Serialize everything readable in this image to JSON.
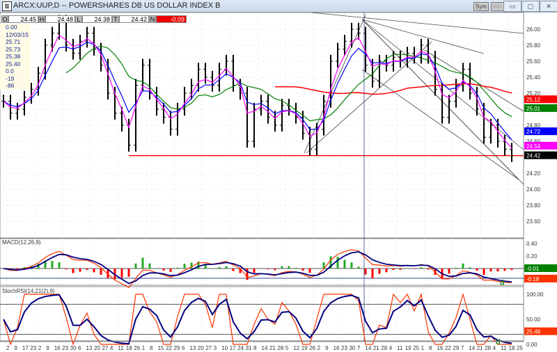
{
  "window": {
    "title": "ARCX:UUP,D -- POWERSHARES DB US DOLLAR INDEX B",
    "buttons": {
      "sym": "Sym",
      "info": "Info",
      "minimize": "▭",
      "restore": "▢",
      "close": "✕"
    }
  },
  "ohlc": {
    "o_label": "O",
    "open": "24.45",
    "h_label": "H",
    "high": "24.48",
    "l_label": "L",
    "low": "24.38",
    "c_label": "T",
    "close": "24.42",
    "n_label": "N",
    "change": "-0.09"
  },
  "info_box": [
    "0.00",
    "12/03/15",
    "25.71",
    "25.73",
    "25.38",
    "25.40",
    "0.0",
    "-19",
    "-86"
  ],
  "colors": {
    "ma_fast": "#ff00ff",
    "ma_mid": "#0000ff",
    "ma_slow": "#008000",
    "ma_long": "#ff0000",
    "support": "#ff0000",
    "macd": "#ff3300",
    "signal": "#000080",
    "hist_up": "#22aa22",
    "hist_down": "#ff0000"
  },
  "chart_data": [
    {
      "type": "bar",
      "title": "ARCX:UUP,D",
      "ylim": [
        23.5,
        26.2
      ],
      "y_ticks": [
        "26.00",
        "25.80",
        "25.60",
        "25.40",
        "25.20",
        "24.80",
        "24.60",
        "24.20",
        "24.00",
        "23.80",
        "23.60"
      ],
      "close": [
        25.1,
        24.95,
        25.0,
        25.15,
        25.25,
        25.45,
        25.8,
        25.95,
        26.1,
        25.8,
        25.7,
        25.85,
        25.95,
        25.75,
        25.55,
        25.2,
        24.95,
        24.8,
        24.55,
        25.3,
        25.55,
        25.2,
        25.0,
        24.9,
        24.75,
        25.0,
        25.2,
        25.3,
        25.5,
        25.4,
        25.3,
        25.5,
        25.6,
        25.3,
        25.2,
        24.6,
        25.0,
        25.1,
        24.9,
        24.8,
        25.05,
        25.0,
        24.9,
        24.7,
        24.5,
        24.75,
        25.1,
        25.6,
        25.75,
        25.85,
        26.0,
        25.95,
        25.55,
        25.35,
        25.6,
        25.55,
        25.65,
        25.6,
        25.7,
        25.65,
        25.8,
        25.65,
        25.25,
        24.9,
        25.1,
        25.3,
        25.5,
        25.2,
        25.0,
        24.65,
        24.8,
        24.6,
        24.5,
        24.42
      ],
      "support_level": 24.42,
      "value_labels": [
        {
          "text": "25.12",
          "color": "#ff0000"
        },
        {
          "text": "25.01",
          "color": "#008000"
        },
        {
          "text": "24.72",
          "color": "#0000ff"
        },
        {
          "text": "24.54",
          "color": "#ff00ff"
        },
        {
          "text": "24.42",
          "color": "#000000"
        }
      ]
    },
    {
      "type": "line",
      "title": "MACD(12,26,9)",
      "ylim": [
        -0.26,
        0.44
      ],
      "y_ticks": [
        "0.40",
        "0.20"
      ],
      "value_labels": [
        {
          "text": "-0.01",
          "color": "#008000"
        },
        {
          "text": "-0.18",
          "color": "#ff3300"
        }
      ],
      "annotation": "d"
    },
    {
      "type": "line",
      "title": "StochRSI(14,21(2),9)",
      "ylim": [
        -5,
        108
      ],
      "y_ticks": [
        "100.00",
        "50.00",
        "0.00"
      ],
      "levels": [
        80,
        20
      ],
      "value_labels": [
        {
          "text": "25.48",
          "color": "#ff3300"
        }
      ],
      "annotation": "d"
    }
  ],
  "x_ticks": [
    "2",
    "9",
    "17",
    "23",
    "2",
    "9",
    "16",
    "23",
    "30",
    "6",
    "13",
    "20",
    "27",
    "4",
    "11",
    "18",
    "26",
    "1",
    "8",
    "15",
    "22",
    "29",
    "6",
    "13",
    "20",
    "27",
    "3",
    "10",
    "17",
    "24",
    "31",
    "8",
    "14",
    "21",
    "28",
    "5",
    "12",
    "19",
    "26",
    "2",
    "9",
    "16",
    "23",
    "30",
    "7",
    "14",
    "21",
    "28",
    "4",
    "11",
    "19",
    "25",
    "1",
    "8",
    "16",
    "22",
    "29",
    "7",
    "14",
    "21",
    "28",
    "4",
    "11",
    "18",
    "25"
  ]
}
